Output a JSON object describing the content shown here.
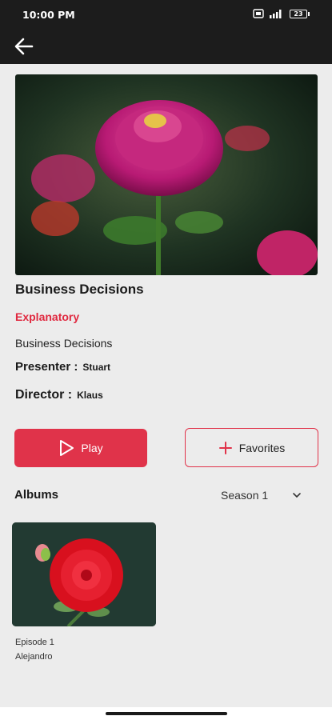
{
  "status_bar": {
    "time": "10:00 PM",
    "battery": "23"
  },
  "content": {
    "title": "Business Decisions",
    "genre": "Explanatory",
    "description": "Business Decisions",
    "presenter_label": "Presenter :",
    "presenter": "Stuart",
    "director_label": "Director :",
    "director": "Klaus"
  },
  "actions": {
    "play_label": "Play",
    "favorites_label": "Favorites"
  },
  "albums": {
    "heading": "Albums",
    "season_selected": "Season 1",
    "episodes": [
      {
        "title": "Episode  1",
        "subtitle": "Alejandro"
      }
    ]
  },
  "colors": {
    "accent": "#e0334a",
    "genre": "#e0283f",
    "bar": "#1c1c1c",
    "background": "#ececec"
  }
}
